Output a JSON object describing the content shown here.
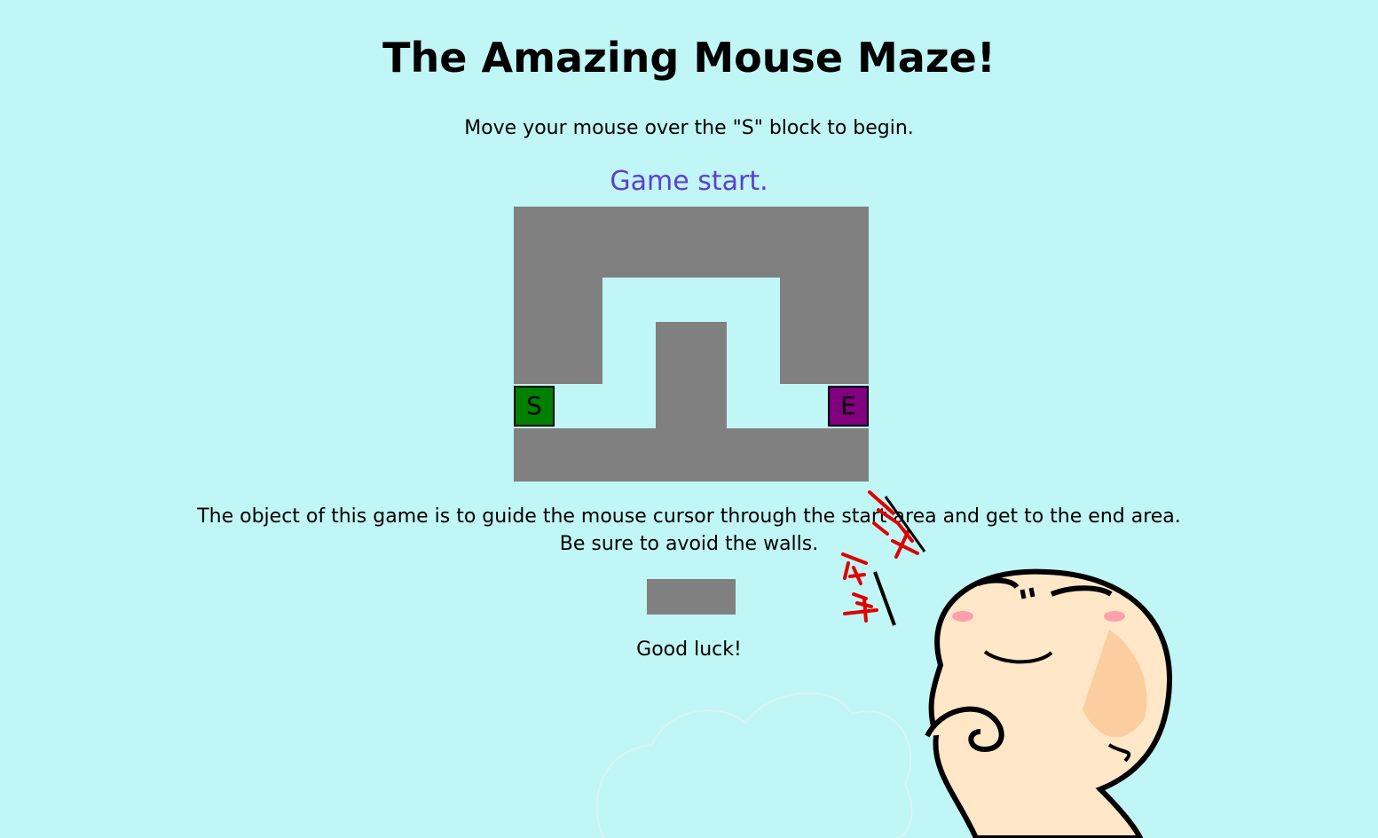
{
  "page": {
    "title": "The Amazing Mouse Maze!",
    "instruction": "Move your mouse over the \"S\" block to begin.",
    "status": "Game start.",
    "description_line1": "The object of this game is to guide the mouse cursor through the start area and get to the end area.",
    "description_line2": "Be sure to avoid the walls.",
    "closing": "Good luck!"
  },
  "maze": {
    "start_label": "S",
    "end_label": "E"
  },
  "colors": {
    "background": "#c0f6f5",
    "wall": "#808080",
    "start": "#008000",
    "end": "#800080",
    "status_text": "#5c3fcf"
  },
  "icons": {
    "mascot": "cartoon-mascot-icon",
    "cloud": "cloud-icon"
  }
}
